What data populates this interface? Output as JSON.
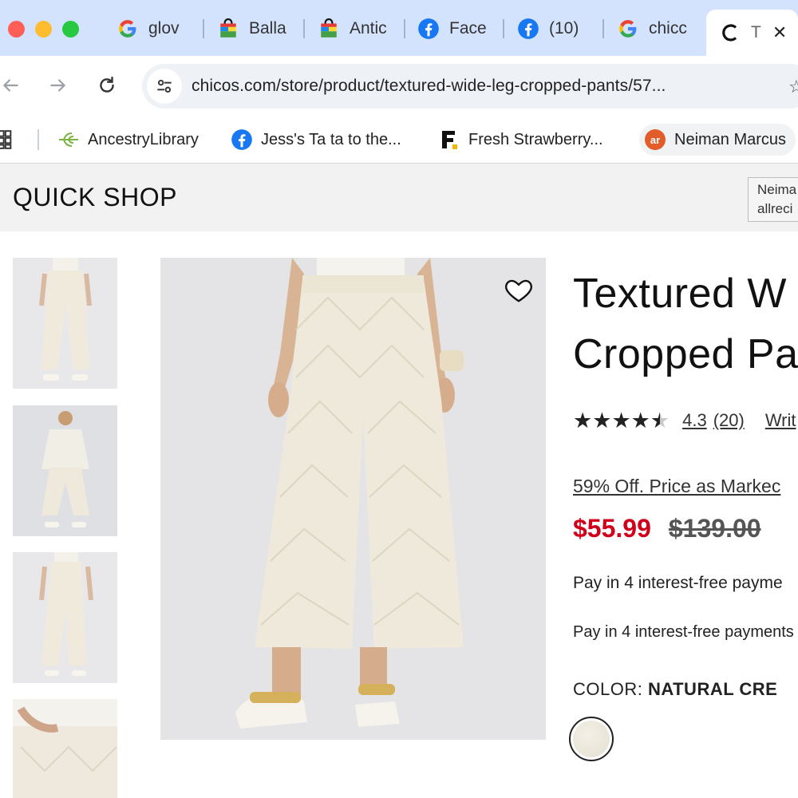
{
  "browser": {
    "tabs": [
      {
        "title": "glov",
        "icon": "google-icon"
      },
      {
        "title": "Balla",
        "icon": "shopping-bag-icon"
      },
      {
        "title": "Antic",
        "icon": "shopping-bag-icon"
      },
      {
        "title": "Face",
        "icon": "facebook-icon"
      },
      {
        "title": "(10)",
        "icon": "facebook-icon"
      },
      {
        "title": "chicc",
        "icon": "google-icon"
      },
      {
        "title": "T",
        "icon": "chicos-icon",
        "active": true
      }
    ],
    "close_glyph": "✕",
    "url": "chicos.com/store/product/textured-wide-leg-cropped-pants/57...",
    "bookmarks": [
      {
        "label": "AncestryLibrary",
        "icon": "ancestry-leaf-icon"
      },
      {
        "label": "Jess's Ta ta to the...",
        "icon": "facebook-icon"
      },
      {
        "label": "Fresh Strawberry...",
        "icon": "food-network-icon"
      },
      {
        "label": "Neiman Marcus",
        "icon": "allrecipes-icon"
      }
    ]
  },
  "quick_shop": {
    "header": "QUICK SHOP",
    "tooltip_line1": "Neima",
    "tooltip_line2": "allreci"
  },
  "product": {
    "title_line1": "Textured W",
    "title_line2": "Cropped Pa",
    "rating": {
      "stars": 4.3,
      "value": "4.3",
      "count": "(20)",
      "write_review": "Writ"
    },
    "promo": "59% Off. Price as Markec",
    "sale_price": "$55.99",
    "original_price": "$139.00",
    "pay_line_1": "Pay in 4 interest-free payme",
    "pay_line_2": "Pay in 4 interest-free payments",
    "color_label": "COLOR:",
    "color_value": "NATURAL CRE"
  },
  "colors": {
    "tabstrip_bg": "#d3e3fd",
    "sale_red": "#d0021b",
    "quickshop_bg": "#f2f2f2"
  }
}
